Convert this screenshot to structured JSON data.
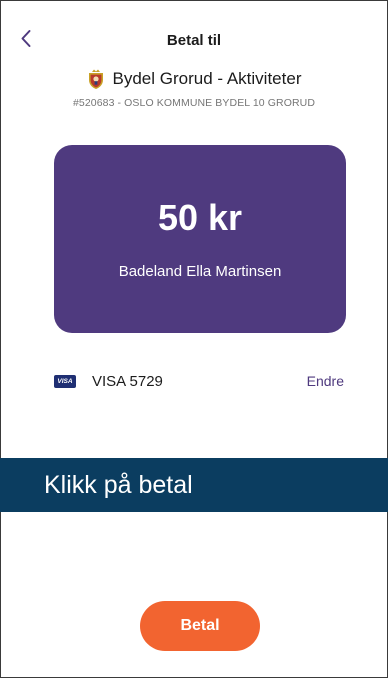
{
  "header": {
    "title": "Betal til",
    "back_icon": "chevron-left-icon"
  },
  "merchant": {
    "name": "Bydel Grorud - Aktiviteter",
    "subtitle": "#520683 - OSLO KOMMUNE BYDEL 10 GRORUD",
    "logo_icon": "coat-of-arms-icon"
  },
  "payment": {
    "amount": "50 kr",
    "payee": "Badeland Ella Martinsen"
  },
  "card": {
    "brand": "VISA",
    "label": "VISA 5729",
    "change_label": "Endre"
  },
  "banner": {
    "text": "Klikk på betal"
  },
  "actions": {
    "pay_label": "Betal"
  },
  "colors": {
    "card_background": "#4f3a7f",
    "link": "#4f3a7f",
    "banner_background": "#0b3d60",
    "pay_button": "#f26430",
    "visa_badge": "#1f2f73"
  }
}
